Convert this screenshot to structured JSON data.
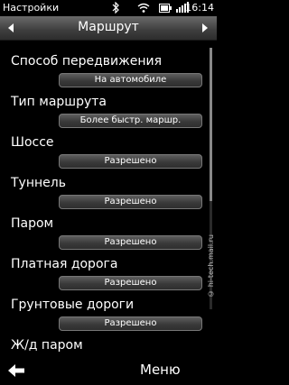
{
  "status": {
    "app_name": "Настройки",
    "time": "16:14"
  },
  "header": {
    "title": "Маршрут"
  },
  "settings": [
    {
      "label": "Способ передвижения",
      "value": "На автомобиле"
    },
    {
      "label": "Тип маршрута",
      "value": "Более быстр. маршр."
    },
    {
      "label": "Шоссе",
      "value": "Разрешено"
    },
    {
      "label": "Туннель",
      "value": "Разрешено"
    },
    {
      "label": "Паром",
      "value": "Разрешено"
    },
    {
      "label": "Платная дорога",
      "value": "Разрешено"
    },
    {
      "label": "Грунтовые дороги",
      "value": "Разрешено"
    },
    {
      "label": "Ж/д паром",
      "value": ""
    }
  ],
  "softkeys": {
    "back_icon": "back-arrow-icon",
    "menu_label": "Меню"
  },
  "watermark": "© hi-tech.mail.ru",
  "colors": {
    "background": "#000000",
    "titlebar": "#4a4a4a",
    "value_button": "#444444",
    "text": "#ffffff"
  }
}
